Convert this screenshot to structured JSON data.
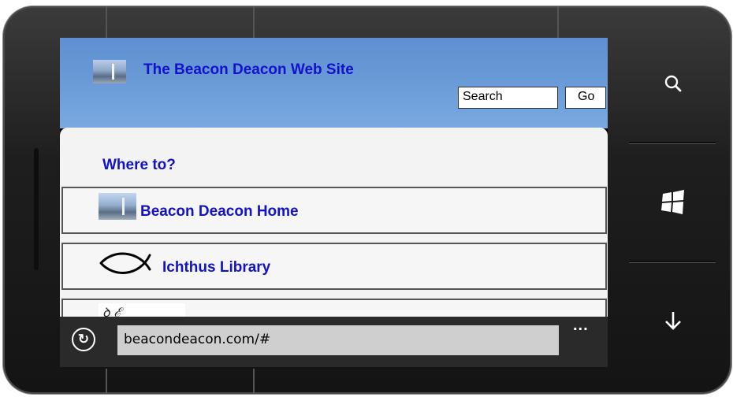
{
  "browser": {
    "site_title": "The Beacon Deacon Web Site",
    "search": {
      "value": "Search"
    },
    "go_label": "Go",
    "where_to": "Where to?",
    "links": [
      {
        "label": "Beacon Deacon Home",
        "icon": "lighthouse-thumbnail"
      },
      {
        "label": "Ichthus Library",
        "icon": "fish-icon"
      },
      {
        "label": "",
        "icon": "script-logo"
      }
    ],
    "third_logo_text": "ꝺ ℰ",
    "address": "beacondeacon.com/#",
    "more_label": "..."
  },
  "hardware_buttons": [
    {
      "name": "search",
      "icon": "search-icon"
    },
    {
      "name": "start",
      "icon": "windows-logo-icon"
    },
    {
      "name": "back",
      "icon": "arrow-down-icon"
    }
  ],
  "colors": {
    "link_blue": "#1212c8",
    "header_blue": "#6a9bd8",
    "appbar": "#2a2a2a"
  }
}
